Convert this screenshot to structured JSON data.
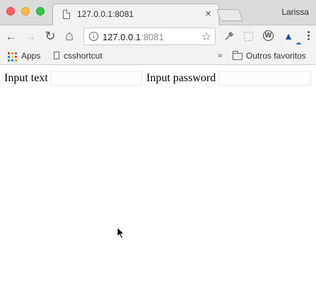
{
  "window": {
    "tab_title": "127.0.0.1:8081",
    "tab_close": "×",
    "profile_name": "Larissa"
  },
  "toolbar": {
    "back_icon": "←",
    "forward_icon": "→",
    "reload_icon": "↻",
    "home_icon": "⌂",
    "url_host": "127.0.0.1",
    "url_port": ":8081",
    "star_icon": "☆"
  },
  "bookmarks": {
    "apps_label": "Apps",
    "item_label": "csshortcut",
    "more_label": "»",
    "folder_label": "Outros favoritos"
  },
  "form": {
    "text_label": "Input text",
    "text_value": "",
    "password_label": "Input password",
    "password_value": ""
  }
}
